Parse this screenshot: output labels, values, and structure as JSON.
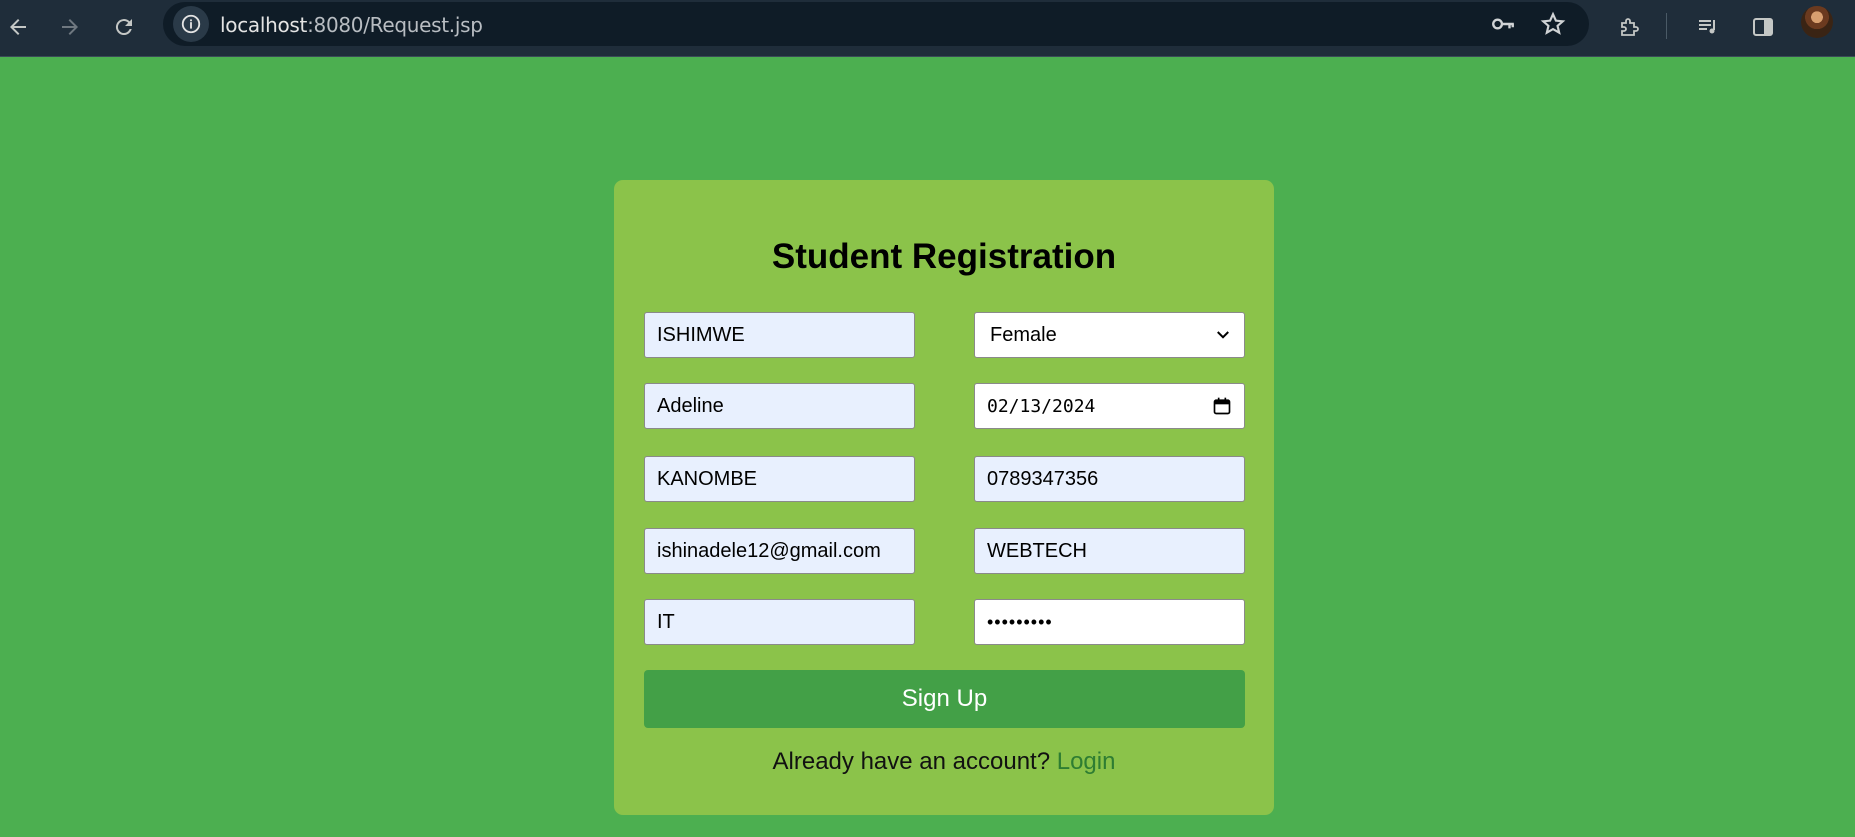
{
  "browser": {
    "url_host": "localhost",
    "url_path": ":8080/Request.jsp",
    "icons": [
      "back-icon",
      "forward-icon",
      "reload-icon",
      "site-info-icon",
      "key-icon",
      "star-icon",
      "extensions-icon",
      "media-control-icon",
      "side-panel-icon",
      "profile-avatar"
    ]
  },
  "form": {
    "title": "Student Registration",
    "fields": {
      "first_name": "ISHIMWE",
      "last_name": "Adeline",
      "address": "KANOMBE",
      "email": "ishinadele12@gmail.com",
      "department": "IT",
      "gender": "Female",
      "dob": "02/13/2024",
      "phone": "0789347356",
      "course": "WEBTECH",
      "password_mask": "•••••••••"
    },
    "signup_label": "Sign Up",
    "footer_text": "Already have an account?",
    "login_label": "Login"
  },
  "colors": {
    "page_bg": "#4caf50",
    "card_bg": "#8bc34a",
    "button_bg": "#43a047",
    "link": "#2e7d32",
    "autofill_bg": "#e8f0fe"
  }
}
